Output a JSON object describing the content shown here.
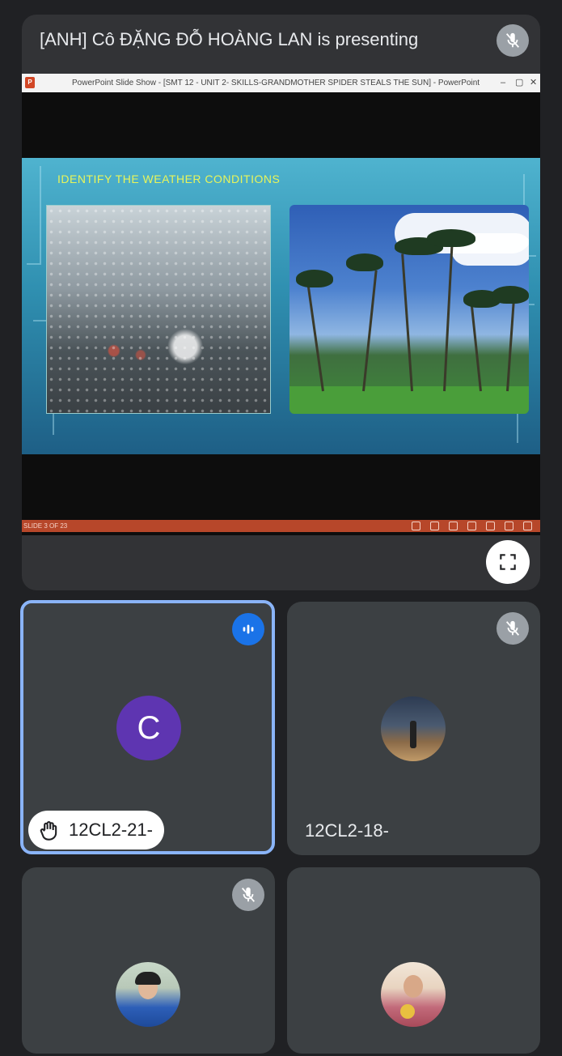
{
  "presentation": {
    "title": "[ANH] Cô ĐẶNG ĐỖ HOÀNG LAN is presenting",
    "window_title": "PowerPoint Slide Show - [SMT 12 - UNIT 2- SKILLS-GRANDMOTHER SPIDER STEALS THE SUN] - PowerPoint",
    "slide_heading": "IDENTIFY THE WEATHER CONDITIONS",
    "slide_counter": "SLIDE 3 OF 23",
    "mic_icon": "mic-off-icon",
    "fullscreen_icon": "fullscreen-icon"
  },
  "participants": [
    {
      "name": "12CL2-21-",
      "avatar_letter": "C",
      "avatar_color": "#5e35b1",
      "hand_raised": true,
      "speaking": true
    },
    {
      "name": "12CL2-18-",
      "muted": true
    },
    {
      "name": "",
      "muted": true
    },
    {
      "name": ""
    }
  ],
  "colors": {
    "background": "#202124",
    "tile": "#3c4043",
    "active_border": "#8ab4f8",
    "speaking_badge": "#1a73e8"
  }
}
